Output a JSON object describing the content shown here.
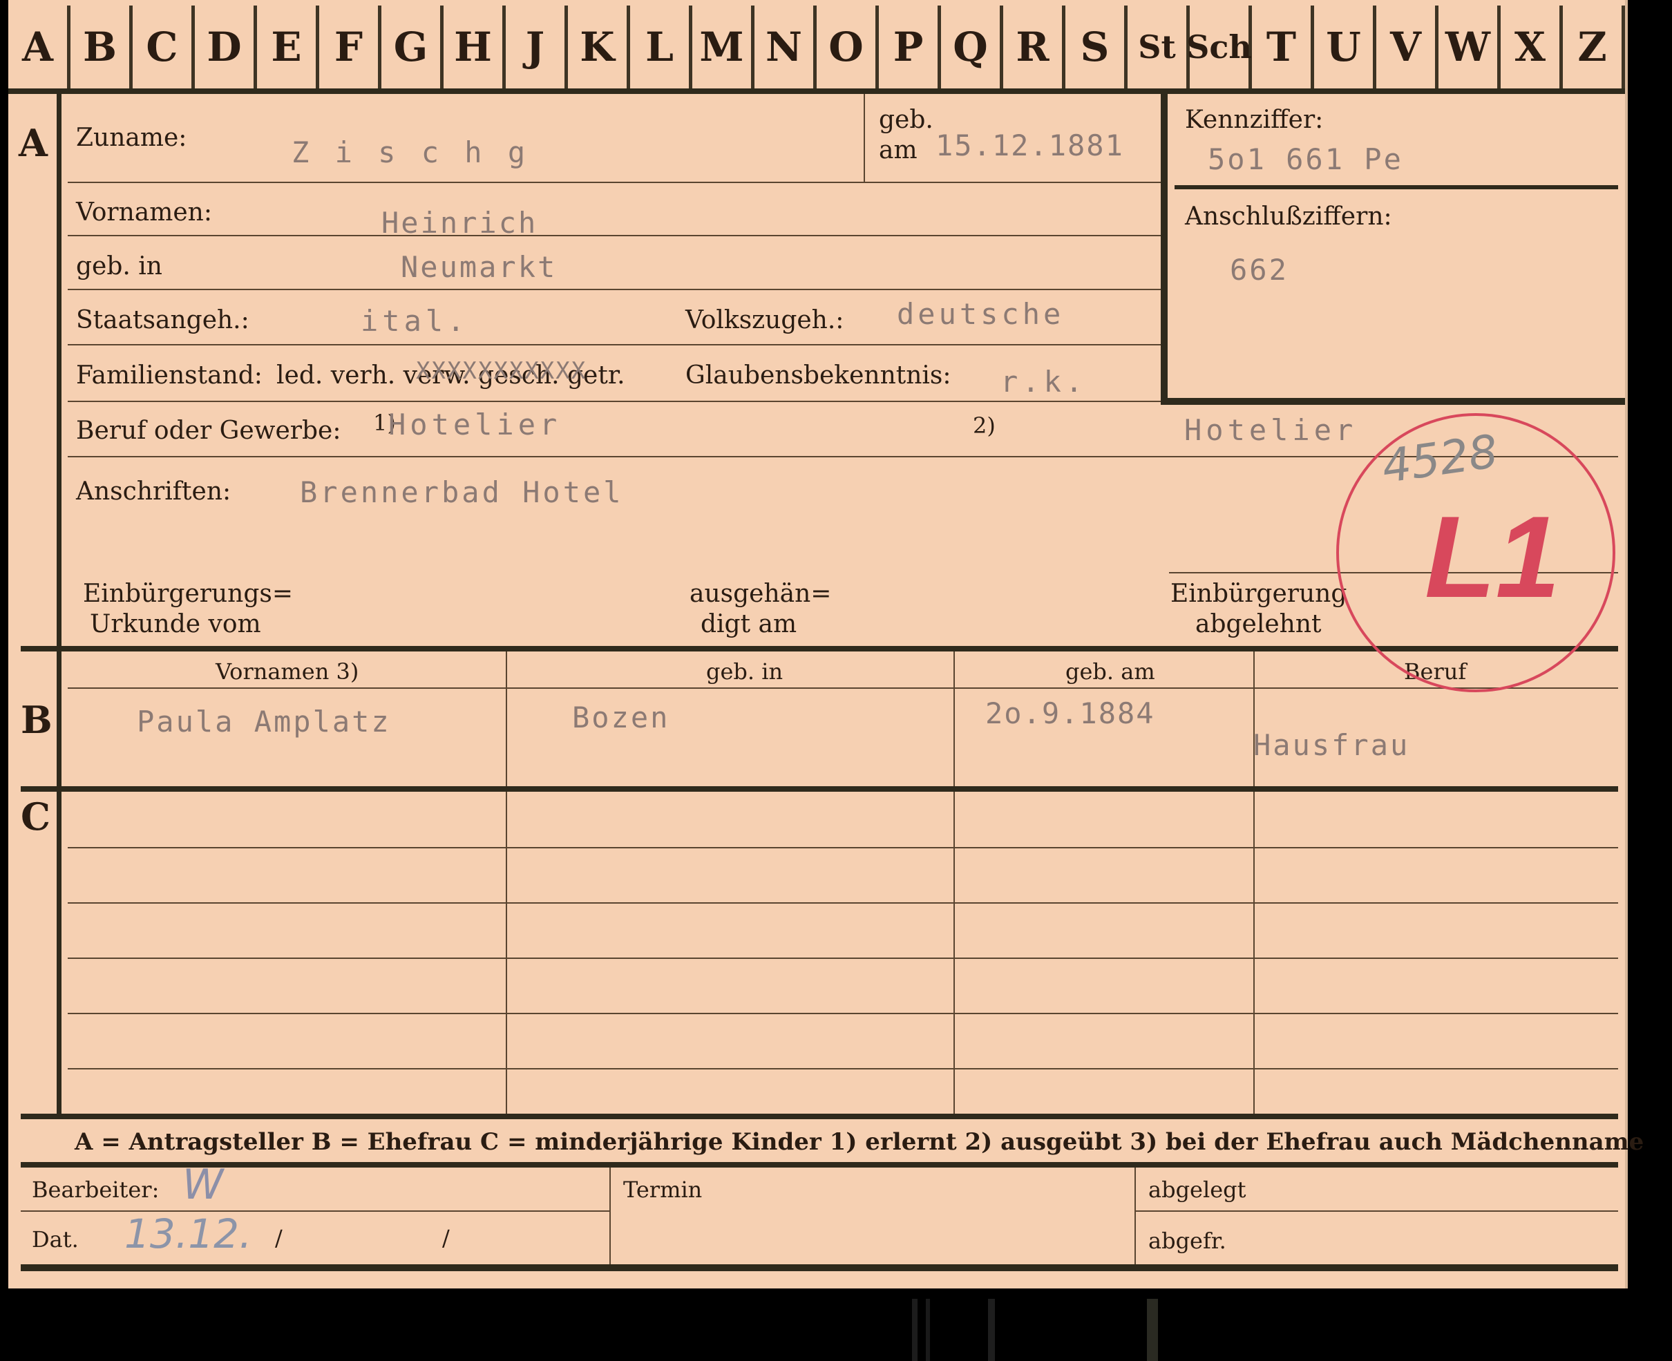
{
  "alphabet": [
    "A",
    "B",
    "C",
    "D",
    "E",
    "F",
    "G",
    "H",
    "J",
    "K",
    "L",
    "M",
    "N",
    "O",
    "P",
    "Q",
    "R",
    "S",
    "St",
    "Sch",
    "T",
    "U",
    "V",
    "W",
    "X",
    "Z"
  ],
  "sections": {
    "a": "A",
    "b": "B",
    "c": "C"
  },
  "applicant": {
    "zuname_label": "Zuname:",
    "zuname": "Z i s c h g",
    "geb_label": "geb.",
    "am_label": "am",
    "geb_am": "15.12.1881",
    "kennziffer_label": "Kennziffer:",
    "kennziffer": "5o1 661 Pe",
    "anschluss_label": "Anschlußziffern:",
    "anschluss": "662",
    "vornamen_label": "Vornamen:",
    "vornamen": "Heinrich",
    "geb_in_label": "geb. in",
    "geb_in": "Neumarkt",
    "staat_label": "Staatsangeh.:",
    "staat": "ital.",
    "volk_label": "Volkszugeh.:",
    "volk": "deutsche",
    "familien_label": "Familienstand:",
    "familien_options": "led. verh. verw. gesch. getr.",
    "familien_strike": "XXXXXXXXXXX",
    "glauben_label": "Glaubensbekenntnis:",
    "glauben": "r.k.",
    "beruf_label": "Beruf oder Gewerbe:",
    "fn1": "1)",
    "fn2": "2)",
    "beruf_erlernt": "Hotelier",
    "beruf_ausgeuebt": "Hotelier",
    "anschrift_label": "Anschriften:",
    "anschrift": "Brennerbad Hotel",
    "urkunde_label_1": "Einbürgerungs=",
    "urkunde_label_2": "Urkunde vom",
    "ausgeh_label_1": "ausgehän=",
    "ausgeh_label_2": "digt am",
    "abgelehnt_label_1": "Einbürgerung",
    "abgelehnt_label_2": "abgelehnt"
  },
  "stamp": {
    "number": "4528",
    "code": "L1"
  },
  "spouse": {
    "headers": [
      "Vornamen 3)",
      "geb. in",
      "geb. am",
      "Beruf"
    ],
    "vornamen": "Paula Amplatz",
    "geb_in": "Bozen",
    "geb_am": "2o.9.1884",
    "beruf": "Hausfrau"
  },
  "legend": "A = Antragsteller   B = Ehefrau   C = minderjährige Kinder   1) erlernt   2) ausgeübt   3) bei der Ehefrau auch Mädchenname",
  "footer": {
    "bearbeiter_label": "Bearbeiter:",
    "dat_label": "Dat.",
    "slash": "/",
    "termin_label": "Termin",
    "abgelegt_label": "abgelegt",
    "abgefr_label": "abgefr.",
    "pencil_initial": "W",
    "pencil_date": "13.12."
  }
}
